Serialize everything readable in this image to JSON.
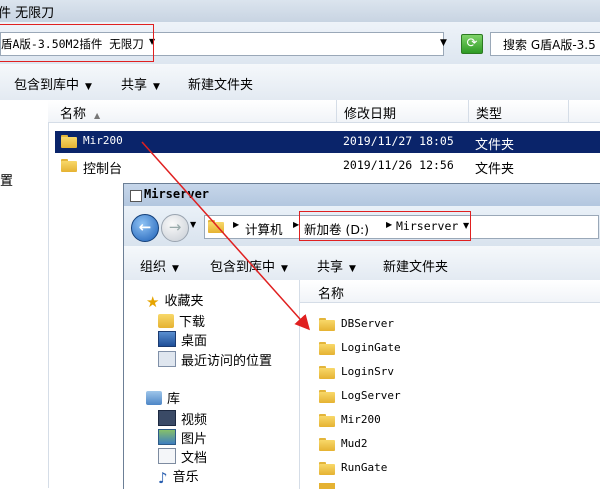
{
  "back_window": {
    "title": "件 无限刀",
    "address": "盾A版-3.50M2插件 无限刀",
    "search_placeholder": "搜索 G盾A版-3.5",
    "toolbar": {
      "include_library": "包含到库中",
      "share": "共享",
      "new_folder": "新建文件夹"
    },
    "nav_fragment": "置",
    "columns": {
      "name": "名称",
      "date": "修改日期",
      "type": "类型"
    },
    "rows": [
      {
        "name": "Mir200",
        "date": "2019/11/27 18:05",
        "type": "文件夹",
        "selected": true
      },
      {
        "name": "控制台",
        "date": "2019/11/26 12:56",
        "type": "文件夹",
        "selected": false
      }
    ]
  },
  "front_window": {
    "title": "Mirserver",
    "breadcrumb": [
      "计算机",
      "新加卷 (D:)",
      "Mirserver"
    ],
    "toolbar": {
      "organize": "组织",
      "include_library": "包含到库中",
      "share": "共享",
      "new_folder": "新建文件夹"
    },
    "nav": {
      "favorites": "收藏夹",
      "favorite_items": [
        "下载",
        "桌面",
        "最近访问的位置"
      ],
      "libraries": "库",
      "library_items": [
        "视频",
        "图片",
        "文档",
        "音乐"
      ]
    },
    "column_name": "名称",
    "folders": [
      "DBServer",
      "LoginGate",
      "LoginSrv",
      "LogServer",
      "Mir200",
      "Mud2",
      "RunGate"
    ]
  },
  "colors": {
    "selection": "#0a246a",
    "annotation": "#e02020"
  }
}
